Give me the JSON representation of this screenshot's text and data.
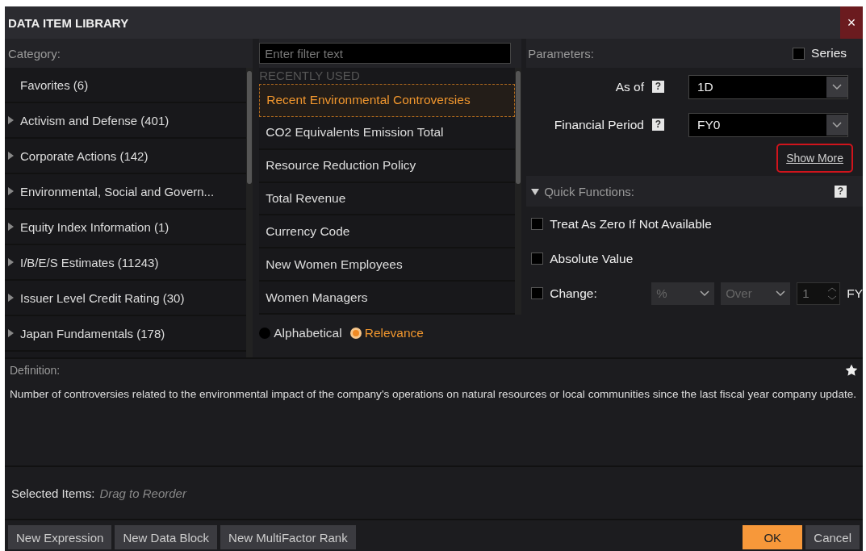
{
  "window": {
    "title": "DATA ITEM LIBRARY",
    "close": "×"
  },
  "category": {
    "label": "Category:",
    "items": [
      {
        "label": "Favorites (6)",
        "expandable": false
      },
      {
        "label": "Activism and Defense (401)",
        "expandable": true
      },
      {
        "label": "Corporate Actions (142)",
        "expandable": true
      },
      {
        "label": "Environmental, Social and Govern...",
        "expandable": true
      },
      {
        "label": "Equity Index Information (1)",
        "expandable": true
      },
      {
        "label": "I/B/E/S Estimates (11243)",
        "expandable": true
      },
      {
        "label": "Issuer Level Credit Rating (30)",
        "expandable": true
      },
      {
        "label": "Japan Fundamentals (178)",
        "expandable": true
      }
    ]
  },
  "items": {
    "filter": {
      "placeholder": "Enter filter text"
    },
    "section": "RECENTLY USED",
    "list": [
      {
        "label": "Recent Environmental Controversies",
        "selected": true
      },
      {
        "label": "CO2 Equivalents Emission Total",
        "selected": false
      },
      {
        "label": "Resource Reduction Policy",
        "selected": false
      },
      {
        "label": "Total Revenue",
        "selected": false
      },
      {
        "label": "Currency Code",
        "selected": false
      },
      {
        "label": "New Women Employees",
        "selected": false
      },
      {
        "label": "Women Managers",
        "selected": false
      }
    ],
    "sort": [
      {
        "label": "Alphabetical",
        "selected": false
      },
      {
        "label": "Relevance",
        "selected": true
      }
    ]
  },
  "parameters": {
    "label": "Parameters:",
    "series": {
      "label": "Series",
      "checked": false
    },
    "fields": [
      {
        "label": "As of",
        "help": "?",
        "value": "1D"
      },
      {
        "label": "Financial Period",
        "help": "?",
        "value": "FY0"
      }
    ],
    "show_more": "Show More",
    "quick_functions": {
      "label": "Quick Functions:",
      "expanded": true,
      "help": "?",
      "options": [
        {
          "kind": "checkbox",
          "label": "Treat As Zero If Not Available",
          "checked": false
        },
        {
          "kind": "checkbox",
          "label": "Absolute Value",
          "checked": false
        },
        {
          "kind": "change",
          "label": "Change:",
          "checked": false,
          "unit": "%",
          "mode": "Over",
          "count": "1",
          "period": "FY"
        }
      ]
    }
  },
  "definition": {
    "label": "Definition:",
    "text": "Number of controversies related to the environmental impact of the company's operations on natural resources or local communities since the last fiscal year company update."
  },
  "selected_items": {
    "label": "Selected Items:",
    "hint": "Drag to Reorder"
  },
  "buttons_left": [
    "New Expression",
    "New Data Block",
    "New MultiFactor Rank"
  ],
  "buttons_right": [
    {
      "label": "OK",
      "primary": true
    },
    {
      "label": "Cancel",
      "primary": false
    }
  ]
}
